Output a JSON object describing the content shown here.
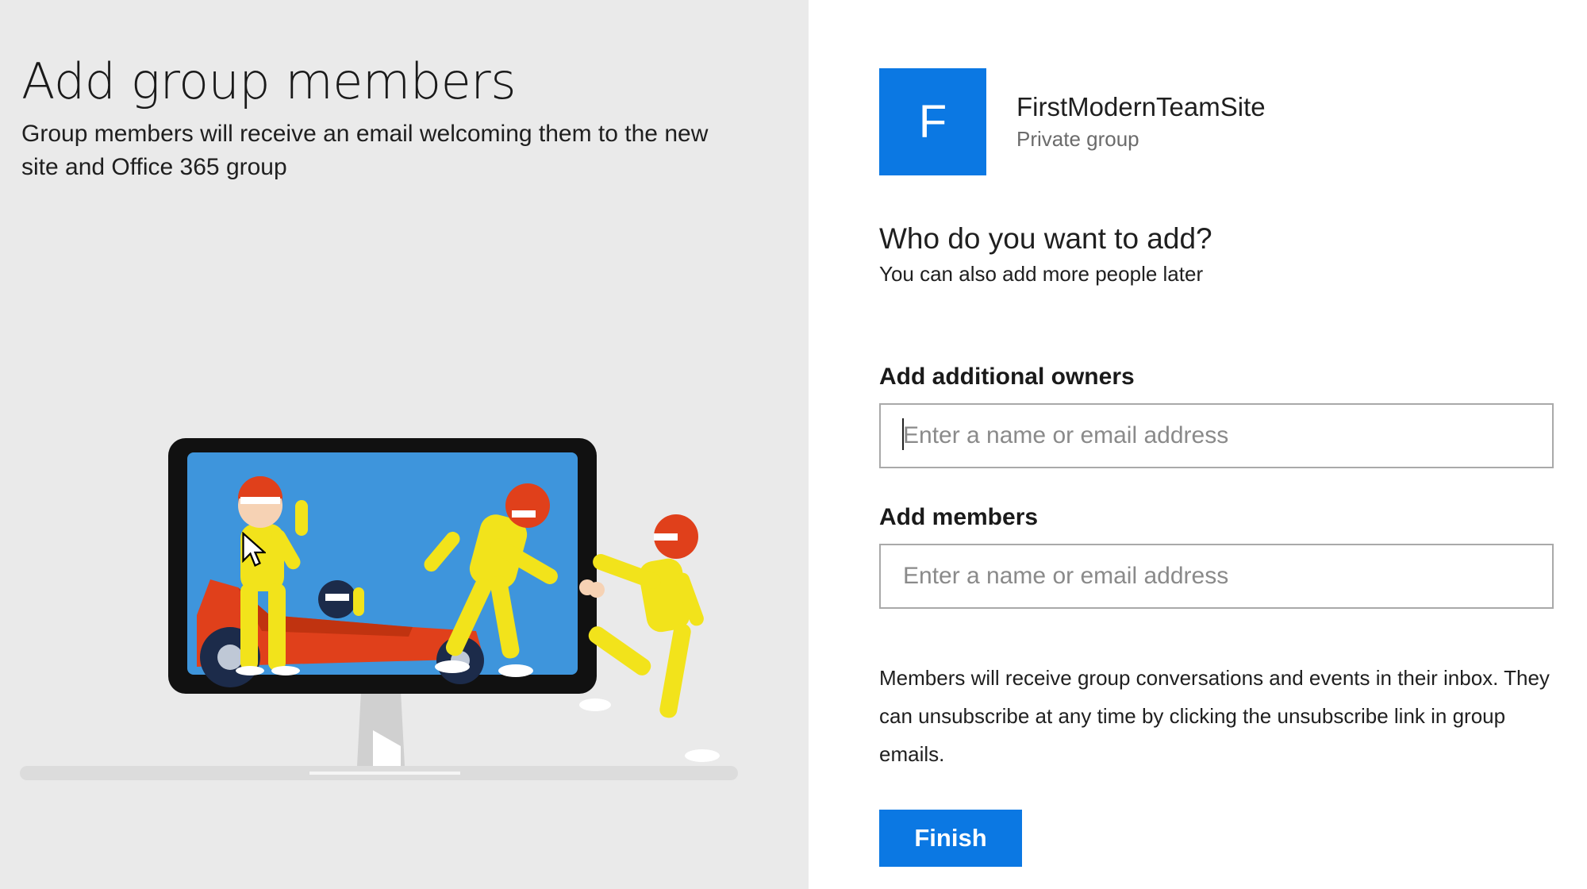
{
  "left": {
    "title": "Add group members",
    "subtitle": "Group members will receive an email welcoming them to the new site and Office 365 group"
  },
  "site": {
    "initial": "F",
    "name": "FirstModernTeamSite",
    "type": "Private group",
    "tile_color": "#0b78e3"
  },
  "form": {
    "question": "Who do you want to add?",
    "hint": "You can also add more people later",
    "owners_label": "Add additional owners",
    "owners_placeholder": "Enter a name or email address",
    "members_label": "Add members",
    "members_placeholder": "Enter a name or email address",
    "note": "Members will receive group conversations and events in their inbox. They can unsubscribe at any time by clicking the unsubscribe link in group emails.",
    "finish_label": "Finish"
  },
  "icons": {
    "illustration": "team-racing-illustration",
    "cursor": "mouse-pointer-icon"
  },
  "colors": {
    "accent": "#0b78e3",
    "left_background": "#eaeaea"
  }
}
